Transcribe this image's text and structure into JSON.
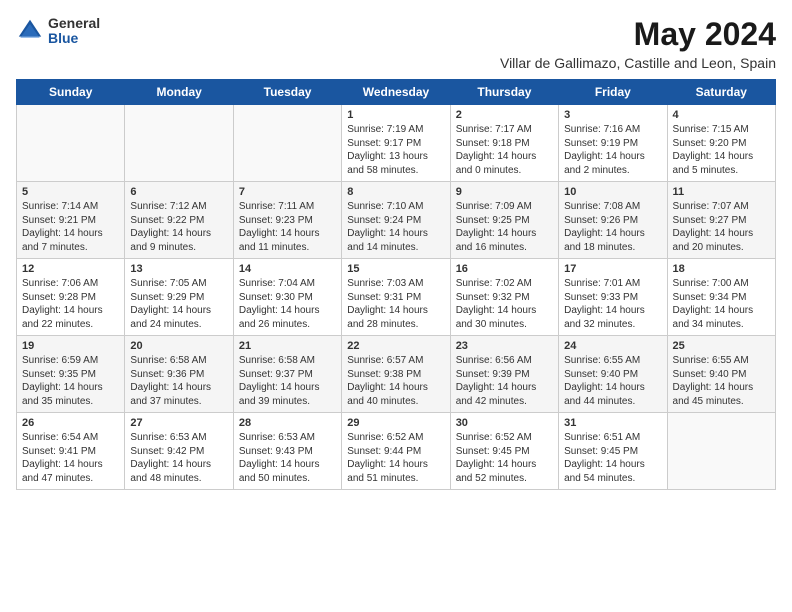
{
  "logo": {
    "general": "General",
    "blue": "Blue"
  },
  "title": {
    "month_year": "May 2024",
    "location": "Villar de Gallimazo, Castille and Leon, Spain"
  },
  "headers": [
    "Sunday",
    "Monday",
    "Tuesday",
    "Wednesday",
    "Thursday",
    "Friday",
    "Saturday"
  ],
  "weeks": [
    [
      {
        "day": "",
        "info": ""
      },
      {
        "day": "",
        "info": ""
      },
      {
        "day": "",
        "info": ""
      },
      {
        "day": "1",
        "info": "Sunrise: 7:19 AM\nSunset: 9:17 PM\nDaylight: 13 hours\nand 58 minutes."
      },
      {
        "day": "2",
        "info": "Sunrise: 7:17 AM\nSunset: 9:18 PM\nDaylight: 14 hours\nand 0 minutes."
      },
      {
        "day": "3",
        "info": "Sunrise: 7:16 AM\nSunset: 9:19 PM\nDaylight: 14 hours\nand 2 minutes."
      },
      {
        "day": "4",
        "info": "Sunrise: 7:15 AM\nSunset: 9:20 PM\nDaylight: 14 hours\nand 5 minutes."
      }
    ],
    [
      {
        "day": "5",
        "info": "Sunrise: 7:14 AM\nSunset: 9:21 PM\nDaylight: 14 hours\nand 7 minutes."
      },
      {
        "day": "6",
        "info": "Sunrise: 7:12 AM\nSunset: 9:22 PM\nDaylight: 14 hours\nand 9 minutes."
      },
      {
        "day": "7",
        "info": "Sunrise: 7:11 AM\nSunset: 9:23 PM\nDaylight: 14 hours\nand 11 minutes."
      },
      {
        "day": "8",
        "info": "Sunrise: 7:10 AM\nSunset: 9:24 PM\nDaylight: 14 hours\nand 14 minutes."
      },
      {
        "day": "9",
        "info": "Sunrise: 7:09 AM\nSunset: 9:25 PM\nDaylight: 14 hours\nand 16 minutes."
      },
      {
        "day": "10",
        "info": "Sunrise: 7:08 AM\nSunset: 9:26 PM\nDaylight: 14 hours\nand 18 minutes."
      },
      {
        "day": "11",
        "info": "Sunrise: 7:07 AM\nSunset: 9:27 PM\nDaylight: 14 hours\nand 20 minutes."
      }
    ],
    [
      {
        "day": "12",
        "info": "Sunrise: 7:06 AM\nSunset: 9:28 PM\nDaylight: 14 hours\nand 22 minutes."
      },
      {
        "day": "13",
        "info": "Sunrise: 7:05 AM\nSunset: 9:29 PM\nDaylight: 14 hours\nand 24 minutes."
      },
      {
        "day": "14",
        "info": "Sunrise: 7:04 AM\nSunset: 9:30 PM\nDaylight: 14 hours\nand 26 minutes."
      },
      {
        "day": "15",
        "info": "Sunrise: 7:03 AM\nSunset: 9:31 PM\nDaylight: 14 hours\nand 28 minutes."
      },
      {
        "day": "16",
        "info": "Sunrise: 7:02 AM\nSunset: 9:32 PM\nDaylight: 14 hours\nand 30 minutes."
      },
      {
        "day": "17",
        "info": "Sunrise: 7:01 AM\nSunset: 9:33 PM\nDaylight: 14 hours\nand 32 minutes."
      },
      {
        "day": "18",
        "info": "Sunrise: 7:00 AM\nSunset: 9:34 PM\nDaylight: 14 hours\nand 34 minutes."
      }
    ],
    [
      {
        "day": "19",
        "info": "Sunrise: 6:59 AM\nSunset: 9:35 PM\nDaylight: 14 hours\nand 35 minutes."
      },
      {
        "day": "20",
        "info": "Sunrise: 6:58 AM\nSunset: 9:36 PM\nDaylight: 14 hours\nand 37 minutes."
      },
      {
        "day": "21",
        "info": "Sunrise: 6:58 AM\nSunset: 9:37 PM\nDaylight: 14 hours\nand 39 minutes."
      },
      {
        "day": "22",
        "info": "Sunrise: 6:57 AM\nSunset: 9:38 PM\nDaylight: 14 hours\nand 40 minutes."
      },
      {
        "day": "23",
        "info": "Sunrise: 6:56 AM\nSunset: 9:39 PM\nDaylight: 14 hours\nand 42 minutes."
      },
      {
        "day": "24",
        "info": "Sunrise: 6:55 AM\nSunset: 9:40 PM\nDaylight: 14 hours\nand 44 minutes."
      },
      {
        "day": "25",
        "info": "Sunrise: 6:55 AM\nSunset: 9:40 PM\nDaylight: 14 hours\nand 45 minutes."
      }
    ],
    [
      {
        "day": "26",
        "info": "Sunrise: 6:54 AM\nSunset: 9:41 PM\nDaylight: 14 hours\nand 47 minutes."
      },
      {
        "day": "27",
        "info": "Sunrise: 6:53 AM\nSunset: 9:42 PM\nDaylight: 14 hours\nand 48 minutes."
      },
      {
        "day": "28",
        "info": "Sunrise: 6:53 AM\nSunset: 9:43 PM\nDaylight: 14 hours\nand 50 minutes."
      },
      {
        "day": "29",
        "info": "Sunrise: 6:52 AM\nSunset: 9:44 PM\nDaylight: 14 hours\nand 51 minutes."
      },
      {
        "day": "30",
        "info": "Sunrise: 6:52 AM\nSunset: 9:45 PM\nDaylight: 14 hours\nand 52 minutes."
      },
      {
        "day": "31",
        "info": "Sunrise: 6:51 AM\nSunset: 9:45 PM\nDaylight: 14 hours\nand 54 minutes."
      },
      {
        "day": "",
        "info": ""
      }
    ]
  ]
}
